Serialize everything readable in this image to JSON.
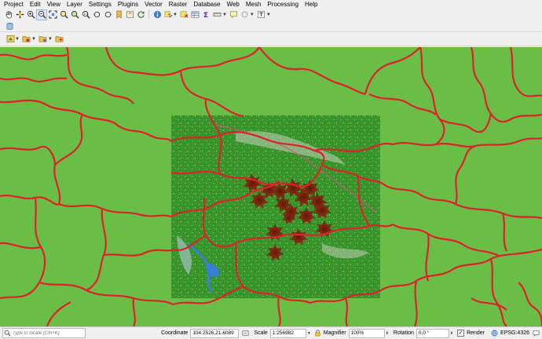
{
  "menu": [
    "Project",
    "Edit",
    "View",
    "Layer",
    "Settings",
    "Plugins",
    "Vector",
    "Raster",
    "Database",
    "Web",
    "Mesh",
    "Processing",
    "Help"
  ],
  "toolbar_icons": {
    "row1": [
      "pan-icon",
      "pan-to-selection-icon",
      "zoom-in-icon",
      "zoom-out-icon",
      "zoom-full-icon",
      "zoom-to-selection-icon",
      "zoom-to-layer-icon",
      "zoom-last-icon",
      "zoom-next-icon",
      "new-bookmark-icon",
      "show-bookmarks-icon",
      "refresh-icon",
      "identify-icon",
      "select-features-icon",
      "deselect-icon",
      "attribute-table-icon",
      "statistics-icon",
      "measure-icon",
      "map-tips-icon",
      "annotation-icon",
      "text-annotation-icon"
    ],
    "row2": [
      "database-icon"
    ],
    "row3": [
      "add-vector-layer-icon",
      "add-raster-layer-icon",
      "add-mesh-layer-icon",
      "new-shapefile-icon"
    ]
  },
  "statusbar": {
    "locator_placeholder": "Type to locate (Ctrl+K)",
    "coordinate_label": "Coordinate",
    "coordinate_value": "104.2526,21.6089",
    "scale_label": "Scale",
    "scale_value": "1:256982",
    "magnifier_label": "Magnifier",
    "magnifier_value": "100%",
    "rotation_label": "Rotation",
    "rotation_value": "0,0 °",
    "render_label": "Render",
    "crs_value": "EPSG:4326"
  },
  "colors": {
    "map_background": "#6abd45",
    "boundary_lines": "#e0202a",
    "raster_dark": "#2e8a24",
    "hotspot_markers": "#8b2b12"
  }
}
